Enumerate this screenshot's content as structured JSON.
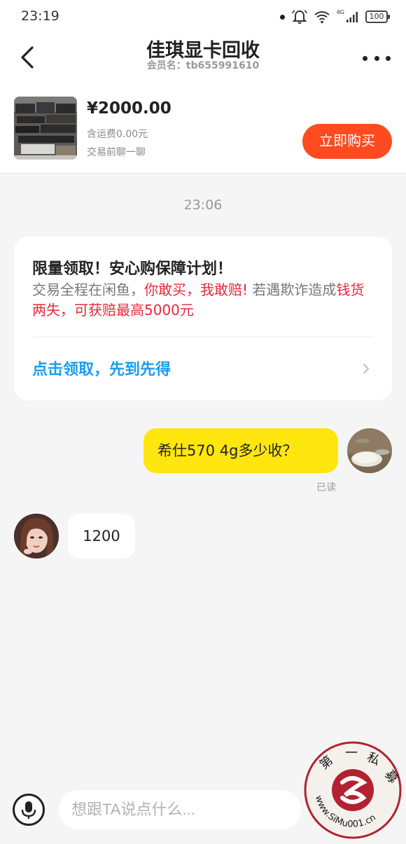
{
  "status_bar": {
    "time": "23:19",
    "network": "4G",
    "battery": "100"
  },
  "nav": {
    "title": "佳琪显卡回收",
    "member": "会员名：tb655991610"
  },
  "product": {
    "price": "¥2000.00",
    "shipping": "含运费0.00元",
    "chat_hint": "交易前聊一聊",
    "buy_label": "立即购买"
  },
  "chat": {
    "timestamp": "23:06",
    "promo": {
      "title": "限量领取！安心购保障计划！",
      "body_1": "交易全程在闲鱼，",
      "body_red_1": "你敢买，我敢赔!",
      "body_2": " 若遇欺诈造成",
      "body_red_2": "钱货两失，可获赔最高5000元",
      "link": "点击领取，先到先得"
    },
    "my_message": "希仕570  4g多少收？",
    "read_status": "已读",
    "their_message": "1200"
  },
  "input": {
    "placeholder": "想跟TA说点什么..."
  },
  "watermark": {
    "chars": [
      "第",
      "一",
      "私",
      "募"
    ],
    "url": "www.SiMu001.cn"
  },
  "colors": {
    "accent_buy": "#ff4b1f",
    "my_bubble": "#ffe60f",
    "promo_link": "#1a9cf0",
    "promo_red": "#e8283a",
    "watermark_red": "#b22230"
  }
}
